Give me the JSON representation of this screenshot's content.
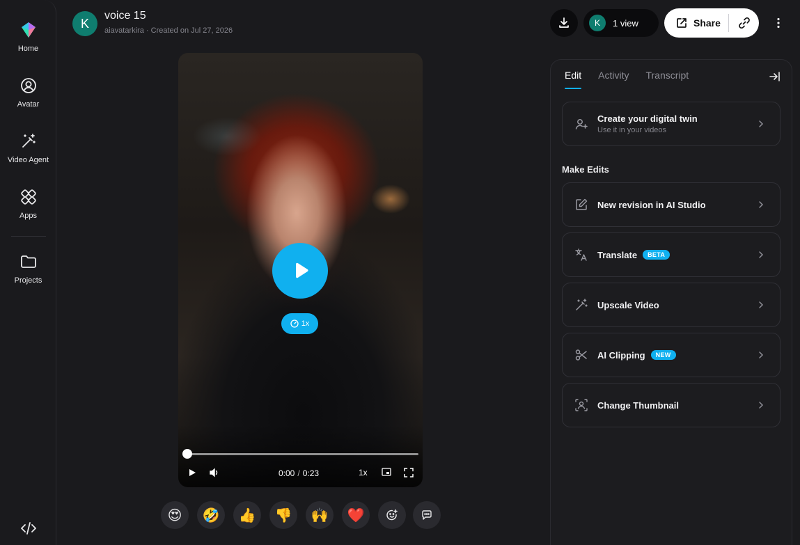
{
  "sidebar": {
    "items": [
      {
        "label": "Home",
        "icon": "logo-icon"
      },
      {
        "label": "Avatar",
        "icon": "avatar-icon"
      },
      {
        "label": "Video Agent",
        "icon": "magic-wand-icon"
      },
      {
        "label": "Apps",
        "icon": "apps-icon"
      },
      {
        "label": "Projects",
        "icon": "folder-icon"
      }
    ],
    "bottom_icon": "code-icon"
  },
  "header": {
    "avatar_letter": "K",
    "title": "voice 15",
    "owner": "aiavatarkira",
    "created": "Created on Jul 27, 2026",
    "views_avatar_letter": "K",
    "views_label": "1 view",
    "share_label": "Share"
  },
  "player": {
    "speed_pill": "1x",
    "time_current": "0:00",
    "time_separator": "/",
    "time_total": "0:23",
    "speed_control": "1x",
    "progress": 0.0
  },
  "reactions": [
    "😍",
    "🤣",
    "👍",
    "👎",
    "🙌",
    "❤️"
  ],
  "panel": {
    "tabs": [
      {
        "label": "Edit",
        "active": true
      },
      {
        "label": "Activity",
        "active": false
      },
      {
        "label": "Transcript",
        "active": false
      }
    ],
    "twin_card": {
      "label": "Create your digital twin",
      "sub": "Use it in your videos"
    },
    "section_title": "Make Edits",
    "edit_cards": [
      {
        "label": "New revision in AI Studio",
        "badge": "",
        "icon": "edit-icon"
      },
      {
        "label": "Translate",
        "badge": "BETA",
        "icon": "translate-icon"
      },
      {
        "label": "Upscale Video",
        "badge": "",
        "icon": "magic-wand-icon"
      },
      {
        "label": "AI Clipping",
        "badge": "NEW",
        "icon": "scissors-icon"
      },
      {
        "label": "Change Thumbnail",
        "badge": "",
        "icon": "thumbnail-icon"
      }
    ]
  },
  "colors": {
    "background": "#1a1a1d",
    "accent": "#10b0ef",
    "avatar": "#0f7d6f"
  }
}
